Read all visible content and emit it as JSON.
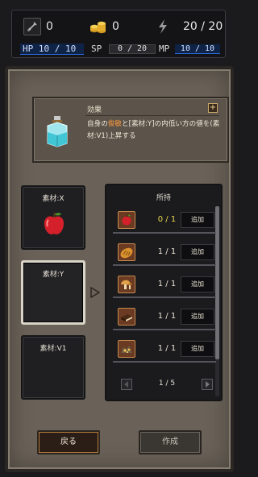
{
  "status": {
    "weapon_count": "0",
    "coins": "0",
    "energy": "20 / 20",
    "hp_label": "HP 10 / 10",
    "sp_label": "SP",
    "sp_value": "0 / 20",
    "mp_label": "MP",
    "mp_value": "10 / 10"
  },
  "effect": {
    "title": "効果",
    "plus": "+",
    "desc_pre": "自身の",
    "desc_highlight": "俊敏",
    "desc_post": "と[素材:Y]の内低い方の値を(素材:V1)上昇する",
    "accent_color": "#ff9a3c"
  },
  "slots": [
    {
      "label": "素材:X",
      "icon": "apple-icon"
    },
    {
      "label": "素材:Y",
      "icon": ""
    },
    {
      "label": "素材:V1",
      "icon": ""
    }
  ],
  "owned": {
    "header": "所持",
    "rows": [
      {
        "icon": "apple-icon",
        "count": "0 / 1",
        "add": "追加"
      },
      {
        "icon": "bread-icon",
        "count": "1 / 1",
        "add": "追加"
      },
      {
        "icon": "mushroom-icon",
        "count": "1 / 1",
        "add": "追加"
      },
      {
        "icon": "book-icon",
        "count": "1 / 1",
        "add": "追加"
      },
      {
        "icon": "ore-icon",
        "count": "1 / 1",
        "add": "追加"
      }
    ],
    "page": "1 / 5"
  },
  "buttons": {
    "back": "戻る",
    "make": "作成"
  }
}
